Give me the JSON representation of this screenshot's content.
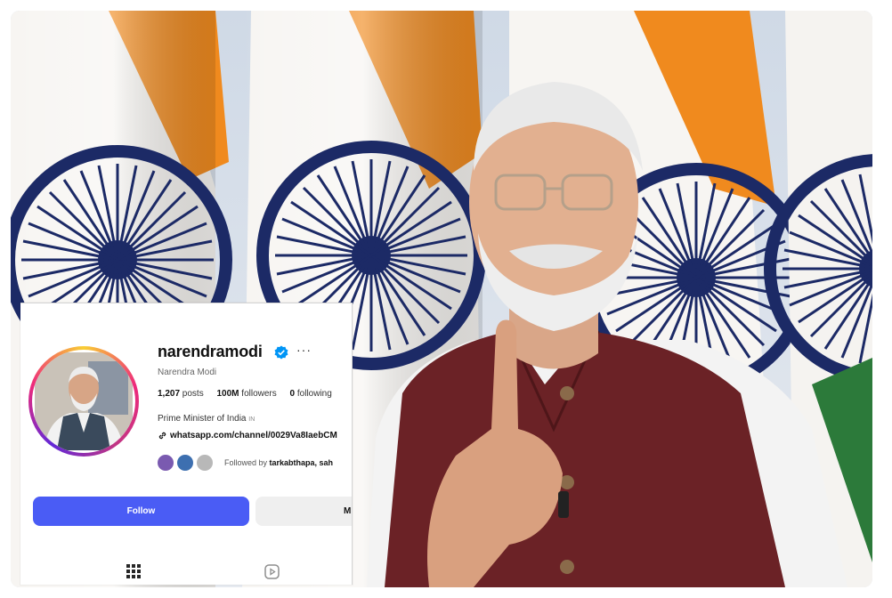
{
  "profile": {
    "username": "narendramodi",
    "more_label": "···",
    "full_name": "Narendra Modi",
    "stats": {
      "posts_count": "1,207",
      "posts_label": " posts",
      "followers_count": "100M",
      "followers_label": " followers",
      "following_count": "0",
      "following_label": " following"
    },
    "bio": "Prime Minister of India",
    "bio_lang": "IN",
    "link": "whatsapp.com/channel/0029Va8IaebCM",
    "followed_by_prefix": "Followed by ",
    "followed_by_names": "tarkabthapa, sah"
  },
  "actions": {
    "follow_label": "Follow",
    "message_label": "M"
  },
  "colors": {
    "follow_button": "#4a5cf5",
    "verified_badge": "#0095f6",
    "flag_saffron": "#f08a1e",
    "flag_green": "#2c7a3a",
    "chakra_navy": "#1c2a66",
    "vest_maroon": "#6b2226"
  },
  "icons": {
    "verified": "verified-badge-icon",
    "link": "link-icon",
    "grid_tab": "grid-icon",
    "reels_tab": "reels-icon"
  }
}
